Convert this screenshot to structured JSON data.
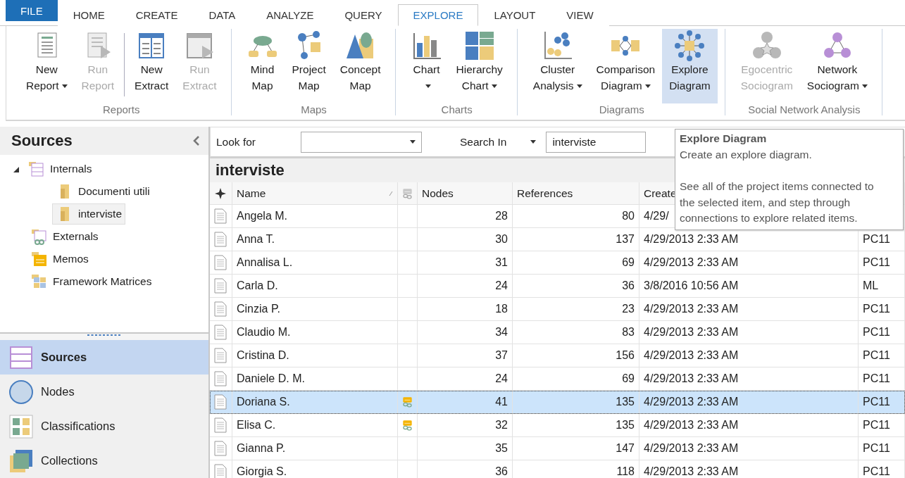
{
  "tabs": [
    {
      "label": "FILE",
      "kind": "file",
      "selected": false
    },
    {
      "label": "HOME",
      "kind": "tab",
      "selected": false
    },
    {
      "label": "CREATE",
      "kind": "tab",
      "selected": false
    },
    {
      "label": "DATA",
      "kind": "tab",
      "selected": false
    },
    {
      "label": "ANALYZE",
      "kind": "tab",
      "selected": false
    },
    {
      "label": "QUERY",
      "kind": "tab",
      "selected": false
    },
    {
      "label": "EXPLORE",
      "kind": "tab",
      "selected": true
    },
    {
      "label": "LAYOUT",
      "kind": "tab",
      "selected": false
    },
    {
      "label": "VIEW",
      "kind": "tab",
      "selected": false
    }
  ],
  "ribbon": {
    "groups": [
      {
        "label": "Reports",
        "buttons": [
          {
            "kind": "report",
            "lines": [
              "New",
              "Report"
            ],
            "dropdown": true,
            "disabled": false,
            "selected": false
          },
          {
            "kind": "run-report",
            "lines": [
              "Run",
              "Report"
            ],
            "dropdown": false,
            "disabled": true,
            "selected": false
          },
          {
            "kind": "separator"
          },
          {
            "kind": "extract",
            "lines": [
              "New",
              "Extract"
            ],
            "dropdown": false,
            "disabled": false,
            "selected": false
          },
          {
            "kind": "run-extract",
            "lines": [
              "Run",
              "Extract"
            ],
            "dropdown": false,
            "disabled": true,
            "selected": false
          }
        ]
      },
      {
        "label": "Maps",
        "buttons": [
          {
            "kind": "mind-map",
            "lines": [
              "Mind",
              "Map"
            ],
            "dropdown": false,
            "disabled": false,
            "selected": false
          },
          {
            "kind": "project-map",
            "lines": [
              "Project",
              "Map"
            ],
            "dropdown": false,
            "disabled": false,
            "selected": false
          },
          {
            "kind": "concept-map",
            "lines": [
              "Concept",
              "Map"
            ],
            "dropdown": false,
            "disabled": false,
            "selected": false
          }
        ]
      },
      {
        "label": "Charts",
        "buttons": [
          {
            "kind": "chart",
            "lines": [
              "Chart"
            ],
            "dropdown": true,
            "disabled": false,
            "selected": false
          },
          {
            "kind": "hierarchy",
            "lines": [
              "Hierarchy",
              "Chart"
            ],
            "dropdown": true,
            "disabled": false,
            "selected": false
          }
        ]
      },
      {
        "label": "Diagrams",
        "buttons": [
          {
            "kind": "cluster",
            "lines": [
              "Cluster",
              "Analysis"
            ],
            "dropdown": true,
            "disabled": false,
            "selected": false
          },
          {
            "kind": "comparison",
            "lines": [
              "Comparison",
              "Diagram"
            ],
            "dropdown": true,
            "disabled": false,
            "selected": false
          },
          {
            "kind": "explore",
            "lines": [
              "Explore",
              "Diagram"
            ],
            "dropdown": false,
            "disabled": false,
            "selected": true
          }
        ]
      },
      {
        "label": "Social Network Analysis",
        "buttons": [
          {
            "kind": "egocentric",
            "lines": [
              "Egocentric",
              "Sociogram"
            ],
            "dropdown": false,
            "disabled": true,
            "selected": false
          },
          {
            "kind": "network",
            "lines": [
              "Network",
              "Sociogram"
            ],
            "dropdown": true,
            "disabled": false,
            "selected": false
          }
        ]
      }
    ]
  },
  "sidebar": {
    "title": "Sources",
    "tree": [
      {
        "label": "Internals",
        "kind": "internals",
        "expanded": true,
        "selected": false,
        "children": [
          {
            "label": "Documenti utili",
            "kind": "folder",
            "selected": false
          },
          {
            "label": "interviste",
            "kind": "folder",
            "selected": true
          }
        ]
      },
      {
        "label": "Externals",
        "kind": "externals",
        "selected": false
      },
      {
        "label": "Memos",
        "kind": "memos",
        "selected": false
      },
      {
        "label": "Framework Matrices",
        "kind": "framework",
        "selected": false
      }
    ],
    "nav": [
      {
        "label": "Sources",
        "kind": "sources",
        "selected": true
      },
      {
        "label": "Nodes",
        "kind": "nodes",
        "selected": false
      },
      {
        "label": "Classifications",
        "kind": "classifications",
        "selected": false
      },
      {
        "label": "Collections",
        "kind": "collections",
        "selected": false
      }
    ]
  },
  "search": {
    "look_for_label": "Look for",
    "search_in_label": "Search In",
    "search_in_value": "interviste"
  },
  "list": {
    "title": "interviste",
    "columns": [
      "Name",
      "Nodes",
      "References",
      "Create"
    ],
    "rows": [
      {
        "name": "Angela M.",
        "linked": false,
        "nodes": "28",
        "references": "80",
        "created": "4/29/",
        "selected": false
      },
      {
        "name": "Anna T.",
        "linked": false,
        "nodes": "30",
        "references": "137",
        "created": "4/29/2013 2:33 AM",
        "by": "PC11",
        "selected": false
      },
      {
        "name": "Annalisa L.",
        "linked": false,
        "nodes": "31",
        "references": "69",
        "created": "4/29/2013 2:33 AM",
        "by": "PC11",
        "selected": false
      },
      {
        "name": "Carla D.",
        "linked": false,
        "nodes": "24",
        "references": "36",
        "created": "3/8/2016 10:56 AM",
        "by": "ML",
        "selected": false
      },
      {
        "name": "Cinzia P.",
        "linked": false,
        "nodes": "18",
        "references": "23",
        "created": "4/29/2013 2:33 AM",
        "by": "PC11",
        "selected": false
      },
      {
        "name": "Claudio M.",
        "linked": false,
        "nodes": "34",
        "references": "83",
        "created": "4/29/2013 2:33 AM",
        "by": "PC11",
        "selected": false
      },
      {
        "name": "Cristina D.",
        "linked": false,
        "nodes": "37",
        "references": "156",
        "created": "4/29/2013 2:33 AM",
        "by": "PC11",
        "selected": false
      },
      {
        "name": "Daniele D. M.",
        "linked": false,
        "nodes": "24",
        "references": "69",
        "created": "4/29/2013 2:33 AM",
        "by": "PC11",
        "selected": false
      },
      {
        "name": "Doriana S.",
        "linked": true,
        "nodes": "41",
        "references": "135",
        "created": "4/29/2013 2:33 AM",
        "by": "PC11",
        "selected": true
      },
      {
        "name": "Elisa C.",
        "linked": true,
        "nodes": "32",
        "references": "135",
        "created": "4/29/2013 2:33 AM",
        "by": "PC11",
        "selected": false
      },
      {
        "name": "Gianna P.",
        "linked": false,
        "nodes": "35",
        "references": "147",
        "created": "4/29/2013 2:33 AM",
        "by": "PC11",
        "selected": false
      },
      {
        "name": "Giorgia S.",
        "linked": false,
        "nodes": "36",
        "references": "118",
        "created": "4/29/2013 2:33 AM",
        "by": "PC11",
        "selected": false
      }
    ]
  },
  "tooltip": {
    "title": "Explore  Diagram",
    "summary": "Create an explore diagram.",
    "detail": "See all of the project items connected to the selected item, and step through connections to explore related items."
  }
}
